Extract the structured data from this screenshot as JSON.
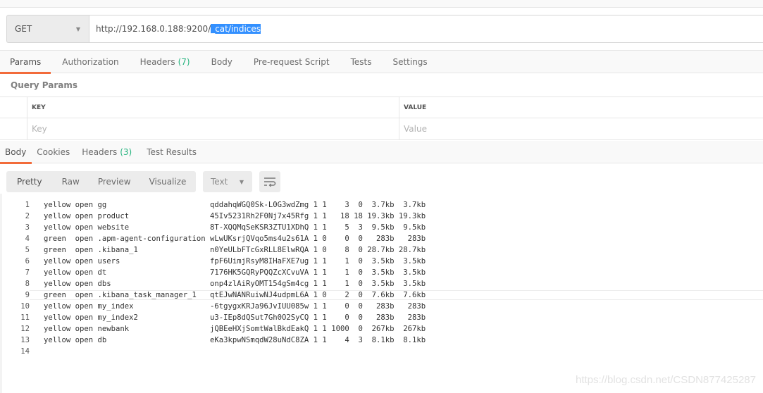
{
  "request": {
    "method": "GET",
    "url_prefix": "http://192.168.0.188:9200/",
    "url_selected": "_cat/indices"
  },
  "request_tabs": [
    {
      "label": "Params",
      "active": true
    },
    {
      "label": "Authorization"
    },
    {
      "label": "Headers",
      "count": "(7)"
    },
    {
      "label": "Body"
    },
    {
      "label": "Pre-request Script"
    },
    {
      "label": "Tests"
    },
    {
      "label": "Settings"
    }
  ],
  "query_params": {
    "title": "Query Params",
    "columns": {
      "key": "KEY",
      "value": "VALUE"
    },
    "placeholders": {
      "key": "Key",
      "value": "Value"
    }
  },
  "response_tabs": [
    {
      "label": "Body",
      "active": true
    },
    {
      "label": "Cookies"
    },
    {
      "label": "Headers",
      "count": "(3)"
    },
    {
      "label": "Test Results"
    }
  ],
  "response_toolbar": {
    "views": [
      "Pretty",
      "Raw",
      "Preview",
      "Visualize"
    ],
    "active_view": "Pretty",
    "format": "Text",
    "wrap_icon": "wrap-lines-icon"
  },
  "response_body": {
    "lines": [
      "yellow open gg                       qddahqWGQ0Sk-L0G3wdZmg 1 1    3  0  3.7kb  3.7kb",
      "yellow open product                  45Iv5231Rh2F0Nj7x45Rfg 1 1   18 18 19.3kb 19.3kb",
      "yellow open website                  8T-XQQMqSeKSR3ZTU1XDhQ 1 1    5  3  9.5kb  9.5kb",
      "green  open .apm-agent-configuration wLwUKsrjQVqo5ms4u2s61A 1 0    0  0   283b   283b",
      "green  open .kibana_1                n0YeULbFTcGxRLL8ElwRQA 1 0    8  0 28.7kb 28.7kb",
      "yellow open users                    fpF6UimjRsyM8IHaFXE7ug 1 1    1  0  3.5kb  3.5kb",
      "yellow open dt                       7176HK5GQRyPQQZcXCvuVA 1 1    1  0  3.5kb  3.5kb",
      "yellow open dbs                      onp4zlAiRyOMT154gSm4cg 1 1    1  0  3.5kb  3.5kb",
      "green  open .kibana_task_manager_1   qtEJwNANRuiwNJ4udpmL6A 1 0    2  0  7.6kb  7.6kb",
      "yellow open my_index                 -6tgygxKRJa96JvIUU085w 1 1    0  0   283b   283b",
      "yellow open my_index2                u3-IEp8dQSut7Gh0O2SyCQ 1 1    0  0   283b   283b",
      "yellow open newbank                  jQBEeHXjSomtWalBkdEakQ 1 1 1000  0  267kb  267kb",
      "yellow open db                       eKa3kpwNSmqdW28uNdC8ZA 1 1    4  3  8.1kb  8.1kb",
      ""
    ],
    "highlighted_line": 9
  },
  "watermark": "https://blog.csdn.net/CSDN877425287"
}
